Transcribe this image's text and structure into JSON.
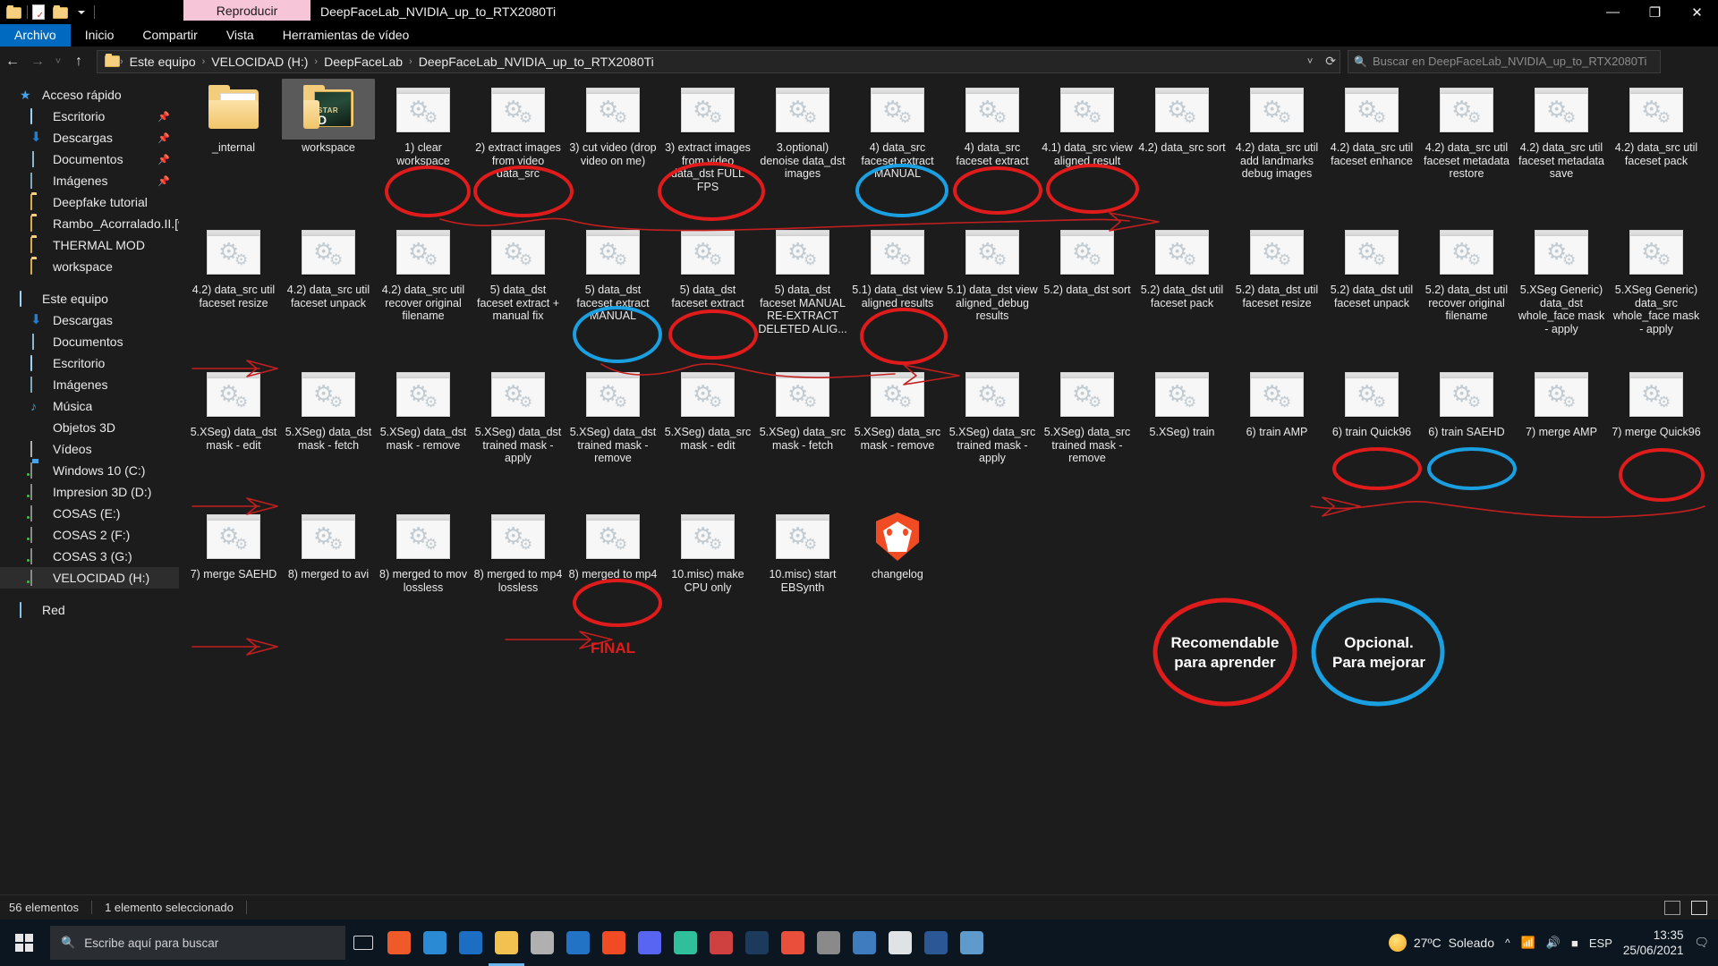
{
  "window": {
    "title": "DeepFaceLab_NVIDIA_up_to_RTX2080Ti",
    "contextual_tab": "Reproducir",
    "contextual_group": "Herramientas de vídeo",
    "minimize_label": "—",
    "maximize_label": "❐",
    "close_label": "✕",
    "help_label": "?"
  },
  "ribbon": {
    "tabs": [
      {
        "label": "Archivo",
        "active": true
      },
      {
        "label": "Inicio",
        "active": false
      },
      {
        "label": "Compartir",
        "active": false
      },
      {
        "label": "Vista",
        "active": false
      }
    ]
  },
  "quick_access_toolbar": {
    "items": [
      "folder-icon",
      "properties-icon",
      "new-folder-icon",
      "customize-chevron-icon"
    ]
  },
  "address_bar": {
    "back_icon": "←",
    "forward_icon": "→",
    "recent_icon": "˅",
    "up_icon": "↑",
    "breadcrumbs": [
      "Este equipo",
      "VELOCIDAD (H:)",
      "DeepFaceLab",
      "DeepFaceLab_NVIDIA_up_to_RTX2080Ti"
    ],
    "separator": "›",
    "dropdown_icon": "˅",
    "refresh_icon": "⟳",
    "search_placeholder": "Buscar en DeepFaceLab_NVIDIA_up_to_RTX2080Ti",
    "search_icon": "search-icon"
  },
  "sidebar": {
    "sections": [
      {
        "header": {
          "label": "Acceso rápido",
          "icon": "star-icon"
        },
        "items": [
          {
            "label": "Escritorio",
            "icon": "desktop-icon",
            "pinned": true
          },
          {
            "label": "Descargas",
            "icon": "download-icon",
            "pinned": true
          },
          {
            "label": "Documentos",
            "icon": "document-icon",
            "pinned": true
          },
          {
            "label": "Imágenes",
            "icon": "pictures-icon",
            "pinned": true
          },
          {
            "label": "Deepfake tutorial",
            "icon": "folder-icon",
            "pinned": false
          },
          {
            "label": "Rambo_Acorralado.II.[www",
            "icon": "folder-icon",
            "pinned": false
          },
          {
            "label": "THERMAL MOD",
            "icon": "folder-icon",
            "pinned": false
          },
          {
            "label": "workspace",
            "icon": "folder-icon",
            "pinned": false
          }
        ]
      },
      {
        "header": {
          "label": "Este equipo",
          "icon": "computer-icon"
        },
        "items": [
          {
            "label": "Descargas",
            "icon": "download-icon",
            "pinned": false
          },
          {
            "label": "Documentos",
            "icon": "document-icon",
            "pinned": false
          },
          {
            "label": "Escritorio",
            "icon": "desktop-icon",
            "pinned": false
          },
          {
            "label": "Imágenes",
            "icon": "pictures-icon",
            "pinned": false
          },
          {
            "label": "Música",
            "icon": "music-icon",
            "pinned": false
          },
          {
            "label": "Objetos 3D",
            "icon": "objects3d-icon",
            "pinned": false
          },
          {
            "label": "Vídeos",
            "icon": "videos-icon",
            "pinned": false
          },
          {
            "label": "Windows 10 (C:)",
            "icon": "drive-windows-icon",
            "pinned": false
          },
          {
            "label": "Impresion 3D (D:)",
            "icon": "drive-icon",
            "pinned": false
          },
          {
            "label": "COSAS (E:)",
            "icon": "drive-icon",
            "pinned": false
          },
          {
            "label": "COSAS 2 (F:)",
            "icon": "drive-icon",
            "pinned": false
          },
          {
            "label": "COSAS 3 (G:)",
            "icon": "drive-icon",
            "pinned": false
          },
          {
            "label": "VELOCIDAD (H:)",
            "icon": "drive-icon",
            "pinned": false,
            "selected": true
          }
        ]
      },
      {
        "header": {
          "label": "Red",
          "icon": "network-icon"
        },
        "items": []
      }
    ]
  },
  "files": [
    {
      "name": "_internal",
      "icon": "folder-icon",
      "row": 0,
      "col": 0
    },
    {
      "name": "workspace",
      "icon": "folder-preview-icon",
      "row": 0,
      "col": 1,
      "selected": true
    },
    {
      "name": "1) clear workspace",
      "icon": "batch-icon",
      "row": 0,
      "col": 2,
      "mark": "red"
    },
    {
      "name": "2) extract images from video data_src",
      "icon": "batch-icon",
      "row": 0,
      "col": 3,
      "mark": "red"
    },
    {
      "name": "3) cut video (drop video on me)",
      "icon": "batch-icon",
      "row": 0,
      "col": 4
    },
    {
      "name": "3) extract images from video data_dst FULL FPS",
      "icon": "batch-icon",
      "row": 0,
      "col": 5,
      "mark": "red"
    },
    {
      "name": "3.optional) denoise data_dst images",
      "icon": "batch-icon",
      "row": 0,
      "col": 6
    },
    {
      "name": "4) data_src faceset extract MANUAL",
      "icon": "batch-icon",
      "row": 0,
      "col": 7,
      "mark": "blue"
    },
    {
      "name": "4) data_src faceset extract",
      "icon": "batch-icon",
      "row": 0,
      "col": 8,
      "mark": "red"
    },
    {
      "name": "4.1) data_src view aligned result",
      "icon": "batch-icon",
      "row": 0,
      "col": 9,
      "mark": "red"
    },
    {
      "name": "4.2) data_src sort",
      "icon": "batch-icon",
      "row": 0,
      "col": 10
    },
    {
      "name": "4.2) data_src util add landmarks debug images",
      "icon": "batch-icon",
      "row": 0,
      "col": 11
    },
    {
      "name": "4.2) data_src util faceset enhance",
      "icon": "batch-icon",
      "row": 0,
      "col": 12
    },
    {
      "name": "4.2) data_src util faceset metadata restore",
      "icon": "batch-icon",
      "row": 0,
      "col": 13
    },
    {
      "name": "4.2) data_src util faceset metadata save",
      "icon": "batch-icon",
      "row": 0,
      "col": 14
    },
    {
      "name": "4.2) data_src util faceset pack",
      "icon": "batch-icon",
      "row": 0,
      "col": 15
    },
    {
      "name": "4.2) data_src util faceset resize",
      "icon": "batch-icon",
      "row": 1,
      "col": 0
    },
    {
      "name": "4.2) data_src util faceset unpack",
      "icon": "batch-icon",
      "row": 1,
      "col": 1
    },
    {
      "name": "4.2) data_src util recover original filename",
      "icon": "batch-icon",
      "row": 1,
      "col": 2
    },
    {
      "name": "5) data_dst faceset extract + manual fix",
      "icon": "batch-icon",
      "row": 1,
      "col": 3
    },
    {
      "name": "5) data_dst faceset extract MANUAL",
      "icon": "batch-icon",
      "row": 1,
      "col": 4,
      "mark": "blue"
    },
    {
      "name": "5) data_dst faceset extract",
      "icon": "batch-icon",
      "row": 1,
      "col": 5,
      "mark": "red"
    },
    {
      "name": "5) data_dst faceset MANUAL RE-EXTRACT DELETED ALIG...",
      "icon": "batch-icon",
      "row": 1,
      "col": 6
    },
    {
      "name": "5.1) data_dst view aligned results",
      "icon": "batch-icon",
      "row": 1,
      "col": 7,
      "mark": "red"
    },
    {
      "name": "5.1) data_dst view aligned_debug results",
      "icon": "batch-icon",
      "row": 1,
      "col": 8
    },
    {
      "name": "5.2) data_dst sort",
      "icon": "batch-icon",
      "row": 1,
      "col": 9
    },
    {
      "name": "5.2) data_dst util faceset pack",
      "icon": "batch-icon",
      "row": 1,
      "col": 10
    },
    {
      "name": "5.2) data_dst util faceset resize",
      "icon": "batch-icon",
      "row": 1,
      "col": 11
    },
    {
      "name": "5.2) data_dst util faceset unpack",
      "icon": "batch-icon",
      "row": 1,
      "col": 12
    },
    {
      "name": "5.2) data_dst util recover original filename",
      "icon": "batch-icon",
      "row": 1,
      "col": 13
    },
    {
      "name": "5.XSeg Generic) data_dst whole_face mask - apply",
      "icon": "batch-icon",
      "row": 1,
      "col": 14
    },
    {
      "name": "5.XSeg Generic) data_src whole_face mask - apply",
      "icon": "batch-icon",
      "row": 1,
      "col": 15
    },
    {
      "name": "5.XSeg) data_dst mask - edit",
      "icon": "batch-icon",
      "row": 2,
      "col": 0
    },
    {
      "name": "5.XSeg) data_dst mask - fetch",
      "icon": "batch-icon",
      "row": 2,
      "col": 1
    },
    {
      "name": "5.XSeg) data_dst mask - remove",
      "icon": "batch-icon",
      "row": 2,
      "col": 2
    },
    {
      "name": "5.XSeg) data_dst trained mask - apply",
      "icon": "batch-icon",
      "row": 2,
      "col": 3
    },
    {
      "name": "5.XSeg) data_dst trained mask - remove",
      "icon": "batch-icon",
      "row": 2,
      "col": 4
    },
    {
      "name": "5.XSeg) data_src mask - edit",
      "icon": "batch-icon",
      "row": 2,
      "col": 5
    },
    {
      "name": "5.XSeg) data_src mask - fetch",
      "icon": "batch-icon",
      "row": 2,
      "col": 6
    },
    {
      "name": "5.XSeg) data_src mask - remove",
      "icon": "batch-icon",
      "row": 2,
      "col": 7
    },
    {
      "name": "5.XSeg) data_src trained mask - apply",
      "icon": "batch-icon",
      "row": 2,
      "col": 8
    },
    {
      "name": "5.XSeg) data_src trained mask - remove",
      "icon": "batch-icon",
      "row": 2,
      "col": 9
    },
    {
      "name": "5.XSeg) train",
      "icon": "batch-icon",
      "row": 2,
      "col": 10
    },
    {
      "name": "6) train AMP",
      "icon": "batch-icon",
      "row": 2,
      "col": 11
    },
    {
      "name": "6) train Quick96",
      "icon": "batch-icon",
      "row": 2,
      "col": 12,
      "mark": "red"
    },
    {
      "name": "6) train SAEHD",
      "icon": "batch-icon",
      "row": 2,
      "col": 13,
      "mark": "blue"
    },
    {
      "name": "7) merge AMP",
      "icon": "batch-icon",
      "row": 2,
      "col": 14
    },
    {
      "name": "7) merge Quick96",
      "icon": "batch-icon",
      "row": 2,
      "col": 15,
      "mark": "red"
    },
    {
      "name": "7) merge SAEHD",
      "icon": "batch-icon",
      "row": 3,
      "col": 0
    },
    {
      "name": "8) merged to avi",
      "icon": "batch-icon",
      "row": 3,
      "col": 1
    },
    {
      "name": "8) merged to mov lossless",
      "icon": "batch-icon",
      "row": 3,
      "col": 2
    },
    {
      "name": "8) merged to mp4 lossless",
      "icon": "batch-icon",
      "row": 3,
      "col": 3
    },
    {
      "name": "8) merged to mp4",
      "icon": "batch-icon",
      "row": 3,
      "col": 4,
      "mark": "red"
    },
    {
      "name": "10.misc) make CPU only",
      "icon": "batch-icon",
      "row": 3,
      "col": 5
    },
    {
      "name": "10.misc) start EBSynth",
      "icon": "batch-icon",
      "row": 3,
      "col": 6
    },
    {
      "name": "changelog",
      "icon": "brave-icon",
      "row": 3,
      "col": 7
    }
  ],
  "annotations": {
    "final_label": "FINAL",
    "legend": [
      {
        "text": "Recomendable\npara aprender",
        "line1": "Recomendable",
        "line2": "para aprender",
        "color": "#e01b1b"
      },
      {
        "text": "Opcional.\nPara mejorar",
        "line1": "Opcional.",
        "line2": "Para mejorar",
        "color": "#1a9fe0"
      }
    ],
    "colors": {
      "red": "#e01b1b",
      "blue": "#1a9fe0"
    }
  },
  "status_bar": {
    "item_count": "56 elementos",
    "selection": "1 elemento seleccionado",
    "view_details_icon": "details-view-icon",
    "view_icons_icon": "large-icons-view-icon"
  },
  "taskbar": {
    "start_icon": "windows-start-icon",
    "search_placeholder": "Escribe aquí para buscar",
    "search_icon": "search-icon",
    "task_view_icon": "task-view-icon",
    "apps": [
      {
        "name": "firefox-icon",
        "color": "#f05a28"
      },
      {
        "name": "edge-icon",
        "color": "#2a8ad4"
      },
      {
        "name": "mail-icon",
        "color": "#1b6ec2"
      },
      {
        "name": "file-explorer-icon",
        "color": "#f3c14f",
        "active": true
      },
      {
        "name": "store-icon",
        "color": "#b0b0b0"
      },
      {
        "name": "outlook-icon",
        "color": "#2272c6"
      },
      {
        "name": "brave-icon",
        "color": "#f04b23"
      },
      {
        "name": "discord-icon",
        "color": "#5865f2"
      },
      {
        "name": "parrot-icon",
        "color": "#2fbf9a"
      },
      {
        "name": "eyedropper-icon",
        "color": "#cf4040"
      },
      {
        "name": "photoshop-icon",
        "color": "#1b3a5c"
      },
      {
        "name": "chrome-icon",
        "color": "#e94f3b"
      },
      {
        "name": "camera-icon",
        "color": "#8a8a8a"
      },
      {
        "name": "calculator-icon",
        "color": "#3f7bbf"
      },
      {
        "name": "rocket-icon",
        "color": "#dfe3e6"
      },
      {
        "name": "word-icon",
        "color": "#2b5797"
      },
      {
        "name": "app-icon",
        "color": "#5e9acb"
      }
    ],
    "weather": {
      "temperature": "27ºC",
      "condition": "Soleado",
      "icon": "sun-icon"
    },
    "tray_icons": [
      "chevron-up-icon",
      "network-icon",
      "volume-icon",
      "battery-icon"
    ],
    "language": "ESP",
    "time": "13:35",
    "date": "25/06/2021",
    "notification_icon": "notification-icon"
  }
}
